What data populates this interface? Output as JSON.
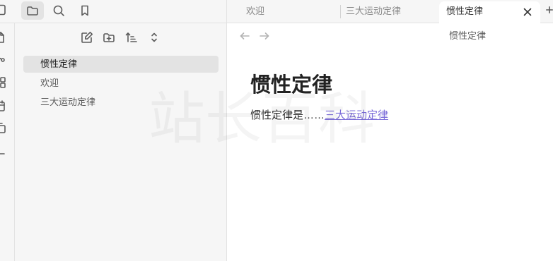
{
  "colors": {
    "accent": "#7b6cd9",
    "sidebar_bg": "#f6f6f6",
    "active_item_bg": "#e3e3e3",
    "text": "#2e2e2e",
    "muted": "#5c5c5c"
  },
  "sidebar_header": {
    "toggle_icon": "sidebar-toggle-icon",
    "buttons": [
      {
        "icon": "folder-icon",
        "active": true
      },
      {
        "icon": "search-icon",
        "active": false
      },
      {
        "icon": "bookmark-icon",
        "active": false
      }
    ]
  },
  "ribbon": {
    "icons": [
      "file-icon",
      "graph-icon",
      "blocks-icon",
      "calendar-icon",
      "copy-icon",
      "dash-icon"
    ]
  },
  "file_explorer": {
    "toolbar": [
      "new-note-icon",
      "new-folder-icon",
      "sort-icon",
      "collapse-icon"
    ],
    "files": [
      {
        "label": "惯性定律",
        "active": true
      },
      {
        "label": "欢迎",
        "active": false
      },
      {
        "label": "三大运动定律",
        "active": false
      }
    ]
  },
  "tabs": [
    {
      "label": "欢迎",
      "active": false
    },
    {
      "label": "三大运动定律",
      "active": false
    },
    {
      "label": "惯性定律",
      "active": true
    }
  ],
  "tab_bar": {
    "close_icon": "close-icon",
    "new_tab_icon": "plus-icon"
  },
  "view_header": {
    "back_icon": "arrow-left-icon",
    "forward_icon": "arrow-right-icon",
    "title": "惯性定律"
  },
  "note": {
    "heading": "惯性定律",
    "text": "惯性定律是……",
    "link": "三大运动定律"
  },
  "watermark": "站长百科"
}
